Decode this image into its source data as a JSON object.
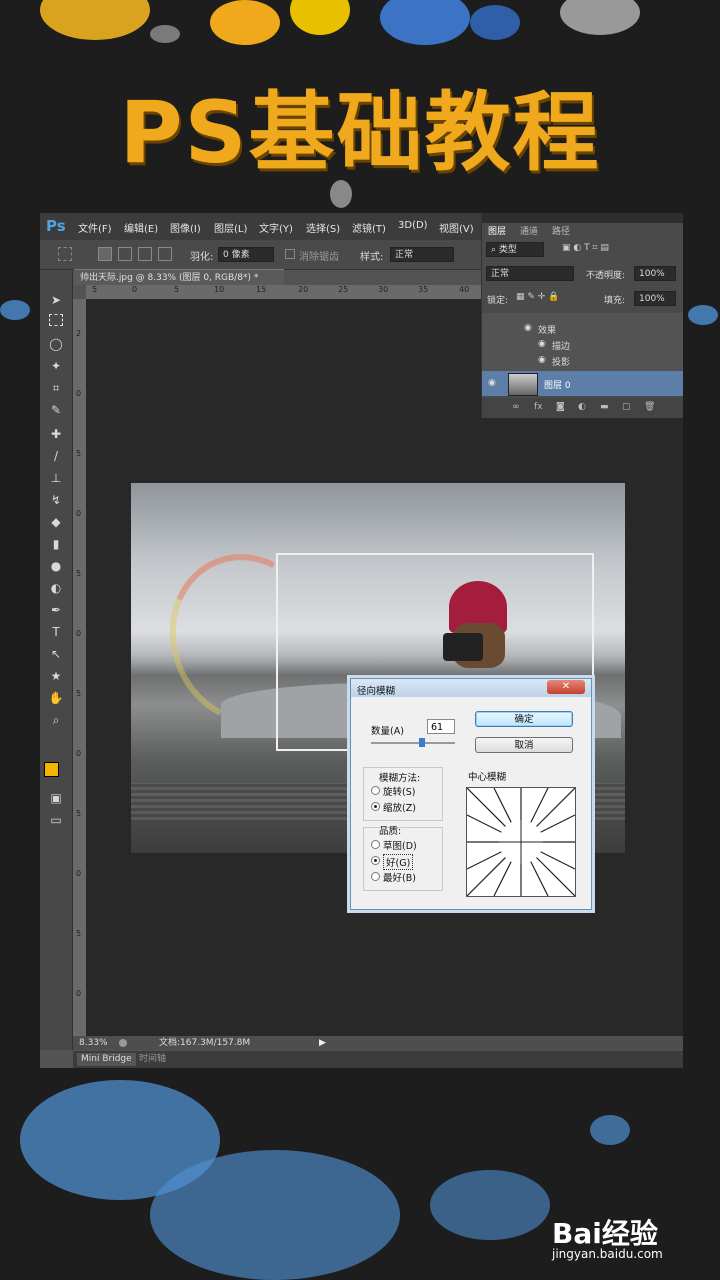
{
  "poster": {
    "title": "PS基础教程"
  },
  "menubar": {
    "logo": "Ps",
    "items": [
      "文件(F)",
      "编辑(E)",
      "图像(I)",
      "图层(L)",
      "文字(Y)",
      "选择(S)",
      "滤镜(T)",
      "3D(D)",
      "视图(V)"
    ]
  },
  "options_bar": {
    "feather_label": "羽化:",
    "feather_value": "0 像素",
    "antialias_label": "消除锯齿",
    "style_label": "样式:",
    "style_value": "正常"
  },
  "document": {
    "tab_title": "帅出天际.jpg @ 8.33% (图层 0, RGB/8*) *",
    "ruler_h_ticks": [
      "5",
      "0",
      "5",
      "10",
      "15",
      "20",
      "25",
      "30",
      "35",
      "40"
    ],
    "ruler_v_ticks": [
      "2",
      "0",
      "5",
      "0",
      "5",
      "0",
      "5",
      "0",
      "5",
      "0",
      "5",
      "0",
      "5"
    ]
  },
  "status_bar": {
    "zoom": "8.33%",
    "doc_size": "文档:167.3M/157.8M"
  },
  "bottom_tabs": [
    "Mini Bridge",
    "时间轴"
  ],
  "layers_panel": {
    "tabs": [
      "图层",
      "通道",
      "路径"
    ],
    "filter_label": "类型",
    "blend_mode": "正常",
    "opacity_label": "不透明度:",
    "opacity_value": "100%",
    "lock_label": "锁定:",
    "fill_label": "填充:",
    "fill_value": "100%",
    "effects_label": "效果",
    "effect_items": [
      "描边",
      "投影"
    ],
    "layer_name": "图层 0"
  },
  "dialog": {
    "title": "径向模糊",
    "amount_label": "数量(A)",
    "amount_value": "61",
    "ok_label": "确定",
    "cancel_label": "取消",
    "method_label": "模糊方法:",
    "methods": [
      "旋转(S)",
      "缩放(Z)"
    ],
    "method_selected": "缩放(Z)",
    "quality_label": "品质:",
    "qualities": [
      "草图(D)",
      "好(G)",
      "最好(B)"
    ],
    "quality_selected": "好(G)",
    "center_label": "中心模糊"
  },
  "watermark": {
    "brand": "Bai经验",
    "url": "jingyan.baidu.com"
  },
  "colors": {
    "accent": "#f0a91c",
    "ps_blue": "#4fa3e0",
    "splash_blue": "#4f8fcf",
    "foreground_swatch": "#f5b400"
  }
}
